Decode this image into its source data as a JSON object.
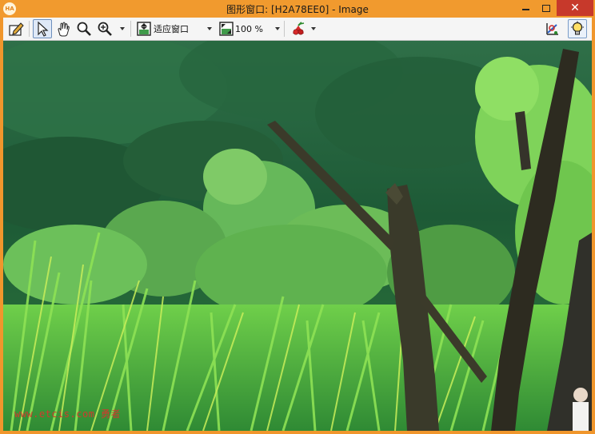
{
  "window": {
    "app_icon_text": "HA",
    "title": "图形窗口: [H2A78EE0] - Image",
    "close_glyph": "✕"
  },
  "toolbar": {
    "icons": [
      "edit-pen-icon",
      "pointer-arrow-icon",
      "pan-hand-icon",
      "magnifier-icon",
      "zoom-in-icon",
      "fit-window-icon",
      "zoom-percent-icon",
      "color-palette-icon",
      "axis-graph-icon",
      "lightbulb-icon"
    ],
    "fit_mode_label": "适应窗口",
    "zoom_level": "100 %"
  },
  "canvas": {
    "watermark": "www.etcis.com 勇者"
  },
  "colors": {
    "titlebar": "#f19a2e",
    "close_button": "#c7392b",
    "toolbar_bg": "#f5f5f5",
    "forest_dark": "#1f5a37",
    "grass_bright": "#7ed94a",
    "watermark": "#d2392e"
  }
}
